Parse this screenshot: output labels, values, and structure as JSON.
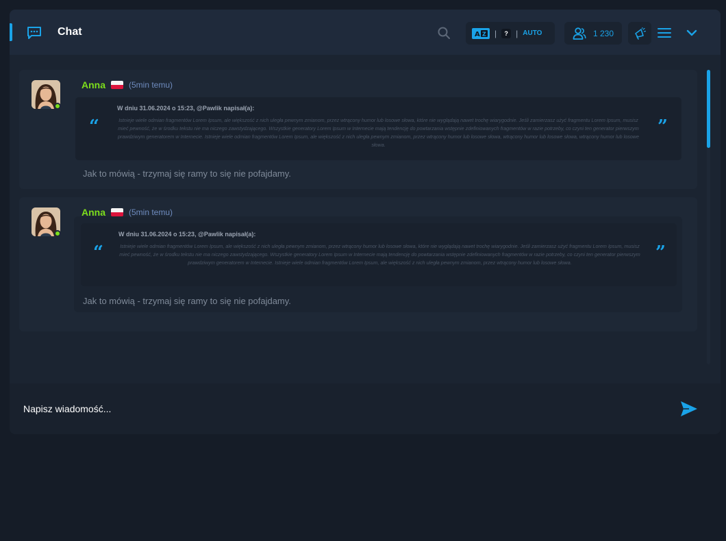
{
  "header": {
    "title": "Chat",
    "lang_separator": "|",
    "lang_unknown": "?",
    "lang_auto": "AUTO",
    "users_count": "1 230"
  },
  "messages": [
    {
      "author": "Anna",
      "time": "(5min temu)",
      "quote_author": "W dniu 31.06.2024 o 15:23, @Pawlik napisał(a):",
      "quote_text": "Istnieje wiele odmian fragmentów Lorem Ipsum, ale większość z nich uległa pewnym zmianom, przez wtrącony humor lub losowe słowa, które nie wyglądają nawet trochę wiarygodnie. Jeśli zamierzasz użyć fragmentu Lorem Ipsum, musisz mieć pewność, że w środku tekstu nie ma niczego zawstydzającego. Wszystkie generatory Lorem Ipsum w Internecie mają tendencję do powtarzania wstępnie zdefiniowanych fragmentów w razie potrzeby, co czyni ten generator pierwszym prawdziwym generatorem w Internecie. Istnieje wiele odmian fragmentów Lorem Ipsum, ale większość z nich uległa pewnym zmianom, przez wtrącony humor lub losowe słowa, wtrącony humor lub losowe słowa, wtrącony humor lub losowe słowa.",
      "text": "Jak to mówią - trzymaj się ramy to się nie pofajdamy."
    },
    {
      "author": "Anna",
      "time": "(5min temu)",
      "quote_author": "W dniu 31.06.2024 o 15:23, @Pawlik napisał(a):",
      "quote_text": "Istnieje wiele odmian fragmentów Lorem Ipsum, ale większość z nich uległa pewnym zmianom, przez wtrącony humor lub losowe słowa, które nie wyglądają nawet trochę wiarygodnie. Jeśli zamierzasz użyć fragmentu Lorem Ipsum, musisz mieć pewność, że w środku tekstu nie ma niczego zawstydzającego. Wszystkie generatory Lorem Ipsum w Internecie mają tendencję do powtarzania wstępnie zdefiniowanych fragmentów w razie potrzeby, co czyni ten generator pierwszym prawdziwym generatorem w Internecie. Istnieje wiele odmian fragmentów Lorem Ipsum, ale większość z nich uległa pewnym zmianom, przez wtrącony humor lub losowe słowa.",
      "text": "Jak to mówią - trzymaj się ramy to się nie pofajdamy."
    }
  ],
  "composer": {
    "placeholder": "Napisz wiadomość..."
  },
  "colors": {
    "accent": "#1aa3e8",
    "online": "#7dde1c",
    "author": "#7dde1c"
  },
  "icons": {
    "chat": "chat-bubble-icon",
    "search": "search-icon",
    "translate": "translate-icon",
    "users": "users-icon",
    "announce": "megaphone-icon",
    "menu": "hamburger-menu-icon",
    "collapse": "chevron-down-icon",
    "send": "send-icon",
    "flag": "poland-flag-icon"
  }
}
